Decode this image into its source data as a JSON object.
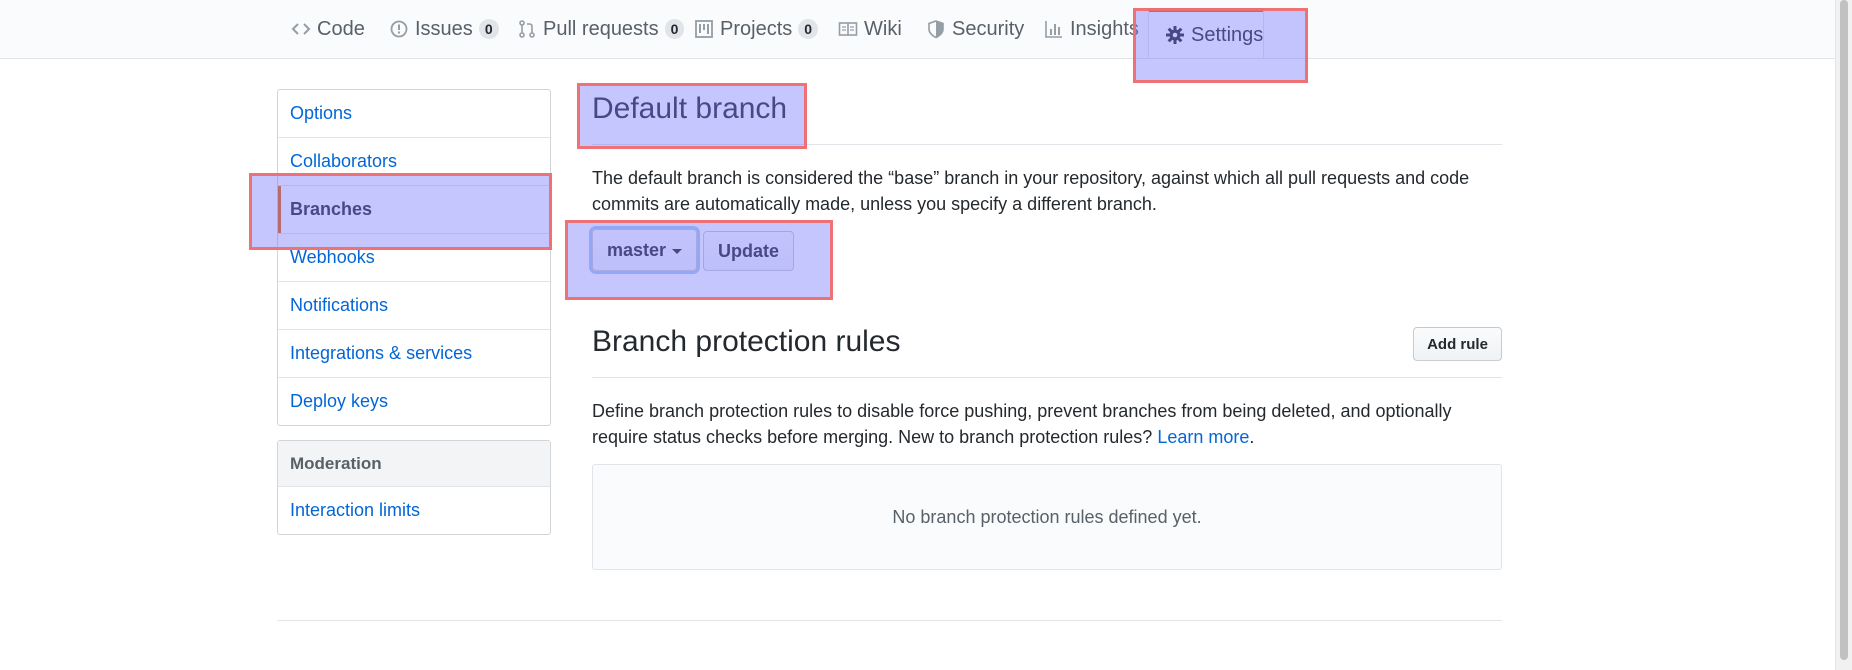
{
  "nav": {
    "tabs": [
      {
        "label": "Code",
        "icon": "code-icon"
      },
      {
        "label": "Issues",
        "icon": "issue-icon",
        "count": "0"
      },
      {
        "label": "Pull requests",
        "icon": "pull-request-icon",
        "count": "0"
      },
      {
        "label": "Projects",
        "icon": "project-icon",
        "count": "0"
      },
      {
        "label": "Wiki",
        "icon": "book-icon"
      },
      {
        "label": "Security",
        "icon": "shield-icon"
      },
      {
        "label": "Insights",
        "icon": "graph-icon"
      },
      {
        "label": "Settings",
        "icon": "gear-icon",
        "selected": true
      }
    ]
  },
  "sidebar": {
    "items": [
      {
        "label": "Options"
      },
      {
        "label": "Collaborators"
      },
      {
        "label": "Branches",
        "active": true
      },
      {
        "label": "Webhooks"
      },
      {
        "label": "Notifications"
      },
      {
        "label": "Integrations & services"
      },
      {
        "label": "Deploy keys"
      }
    ],
    "moderation": {
      "heading": "Moderation",
      "items": [
        {
          "label": "Interaction limits"
        }
      ]
    }
  },
  "default_branch": {
    "title": "Default branch",
    "description": "The default branch is considered the “base” branch in your repository, against which all pull requests and code commits are automatically made, unless you specify a different branch.",
    "selected_branch": "master",
    "update_label": "Update"
  },
  "protection": {
    "title": "Branch protection rules",
    "add_rule_label": "Add rule",
    "description": "Define branch protection rules to disable force pushing, prevent branches from being deleted, and optionally require status checks before merging. New to branch protection rules?",
    "learn_more": "Learn more",
    "period": ".",
    "empty_text": "No branch protection rules defined yet."
  },
  "colors": {
    "link": "#0366d6",
    "accent": "#e36209",
    "highlight_fill": "#7878ff",
    "highlight_border": "#f06e6e"
  }
}
